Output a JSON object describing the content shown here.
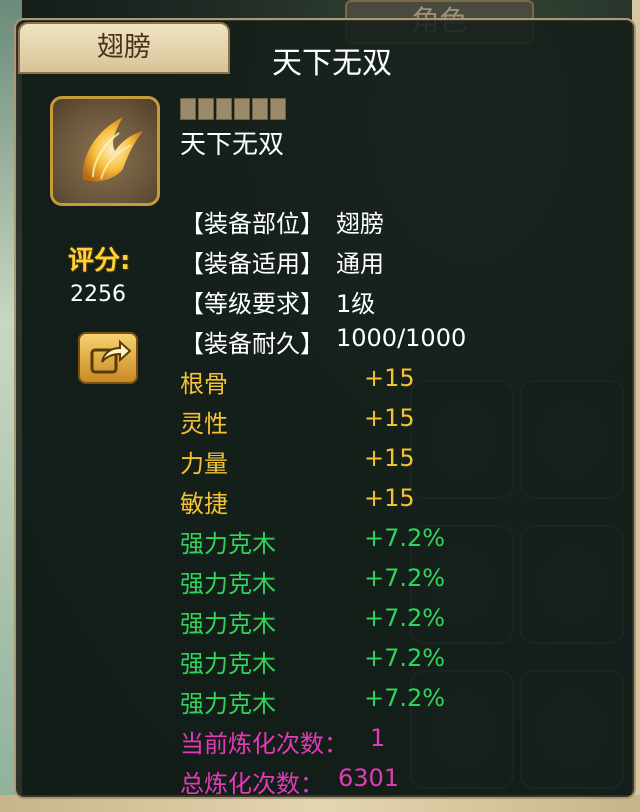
{
  "tab": {
    "label": "翅膀"
  },
  "title": "天下无双",
  "item": {
    "name": "天下无双",
    "icon": "golden-wing-icon",
    "stars": 6
  },
  "score": {
    "label": "评分:",
    "value": "2256"
  },
  "share": {
    "icon": "share-arrow-icon"
  },
  "equip_info": [
    {
      "key": "【装备部位】",
      "value": "翅膀"
    },
    {
      "key": "【装备适用】",
      "value": "通用"
    },
    {
      "key": "【等级要求】",
      "value": "1级"
    },
    {
      "key": "【装备耐久】",
      "value": "1000/1000"
    }
  ],
  "base_stats": [
    {
      "name": "根骨",
      "value": "+15"
    },
    {
      "name": "灵性",
      "value": "+15"
    },
    {
      "name": "力量",
      "value": "+15"
    },
    {
      "name": "敏捷",
      "value": "+15"
    }
  ],
  "bonus_stats": [
    {
      "name": "强力克木",
      "value": "+7.2%"
    },
    {
      "name": "强力克木",
      "value": "+7.2%"
    },
    {
      "name": "强力克木",
      "value": "+7.2%"
    },
    {
      "name": "强力克木",
      "value": "+7.2%"
    },
    {
      "name": "强力克木",
      "value": "+7.2%"
    }
  ],
  "refine": [
    {
      "key": "当前炼化次数：",
      "value": "1"
    },
    {
      "key": "总炼化次数：",
      "value": "6301"
    }
  ],
  "background": {
    "tab_label": "角色"
  },
  "colors": {
    "white": "#ffffff",
    "yellow": "#f4c330",
    "green": "#2fd45a",
    "pink": "#e23ab6",
    "score": "#ffd23a"
  }
}
